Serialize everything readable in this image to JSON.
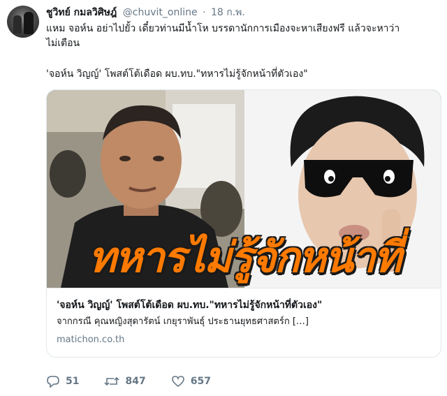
{
  "author": {
    "name": "ชูวิทย์ กมลวิศิษฎ์",
    "handle": "@chuvit_online",
    "separator": "·",
    "date": "18 ก.พ."
  },
  "tweet": {
    "line1": "แหม จอห์น อย่าไปยั้ว เดี๋ยวท่านมีน้ำโห บรรดานักการเมืองจะหาเสียงฟรี แล้วจะหาว่า",
    "line2": "ไม่เตือน",
    "quote": "'จอห์น วิญญ์' โพสต์โต้เดือด ผบ.ทบ.\"ทหารไม่รู้จักหน้าที่ตัวเอง\""
  },
  "card": {
    "image_headline": "ทหารไม่รู้จักหน้าที่",
    "title": "'จอห์น วิญญ์' โพสต์โต้เดือด ผบ.ทบ.\"ทหารไม่รู้จักหน้าที่ตัวเอง\"",
    "description": "จากกรณี คุณหญิงสุดารัตน์ เกยุราพันธุ์ ประธานยุทธศาสตร์ก […]",
    "domain": "matichon.co.th"
  },
  "actions": {
    "replies": "51",
    "retweets": "847",
    "likes": "657",
    "reply_icon": "reply-icon",
    "retweet_icon": "retweet-icon",
    "like_icon": "heart-icon"
  },
  "colors": {
    "secondary_text": "#657786",
    "headline_orange": "#ff7a00",
    "border": "#e1e8ed"
  }
}
